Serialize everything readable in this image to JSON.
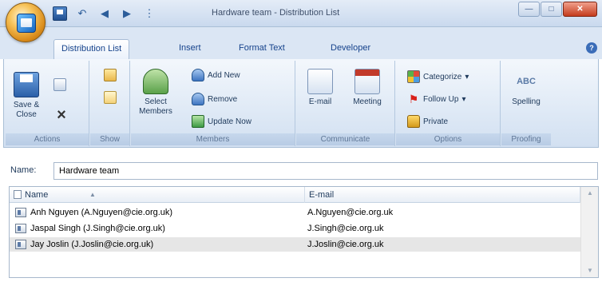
{
  "window": {
    "title": "Hardware team - Distribution List"
  },
  "tabs": [
    {
      "label": "Distribution List",
      "active": true
    },
    {
      "label": "Insert",
      "active": false
    },
    {
      "label": "Format Text",
      "active": false
    },
    {
      "label": "Developer",
      "active": false
    }
  ],
  "ribbon": {
    "actions": {
      "label": "Actions",
      "save_close": "Save & Close"
    },
    "show": {
      "label": "Show"
    },
    "members": {
      "label": "Members",
      "select_members": "Select Members",
      "add_new": "Add New",
      "remove": "Remove",
      "update_now": "Update Now"
    },
    "communicate": {
      "label": "Communicate",
      "email": "E-mail",
      "meeting": "Meeting"
    },
    "options": {
      "label": "Options",
      "categorize": "Categorize",
      "follow_up": "Follow Up",
      "private": "Private"
    },
    "proofing": {
      "label": "Proofing",
      "spelling": "Spelling",
      "spelling_icon_text": "ABC"
    }
  },
  "name_field": {
    "label": "Name:",
    "value": "Hardware team"
  },
  "list": {
    "columns": [
      "Name",
      "E-mail"
    ],
    "rows": [
      {
        "name": "Anh Nguyen (A.Nguyen@cie.org.uk)",
        "email": "A.Nguyen@cie.org.uk",
        "selected": false
      },
      {
        "name": "Jaspal Singh (J.Singh@cie.org.uk)",
        "email": "J.Singh@cie.org.uk",
        "selected": false
      },
      {
        "name": "Jay Joslin (J.Joslin@cie.org.uk)",
        "email": "J.Joslin@cie.org.uk",
        "selected": true
      }
    ]
  },
  "icons": [
    "office-button-icon",
    "save-icon",
    "undo-icon",
    "redo-icon",
    "customize-icon",
    "minimize-icon",
    "maximize-icon",
    "close-icon",
    "help-icon"
  ]
}
